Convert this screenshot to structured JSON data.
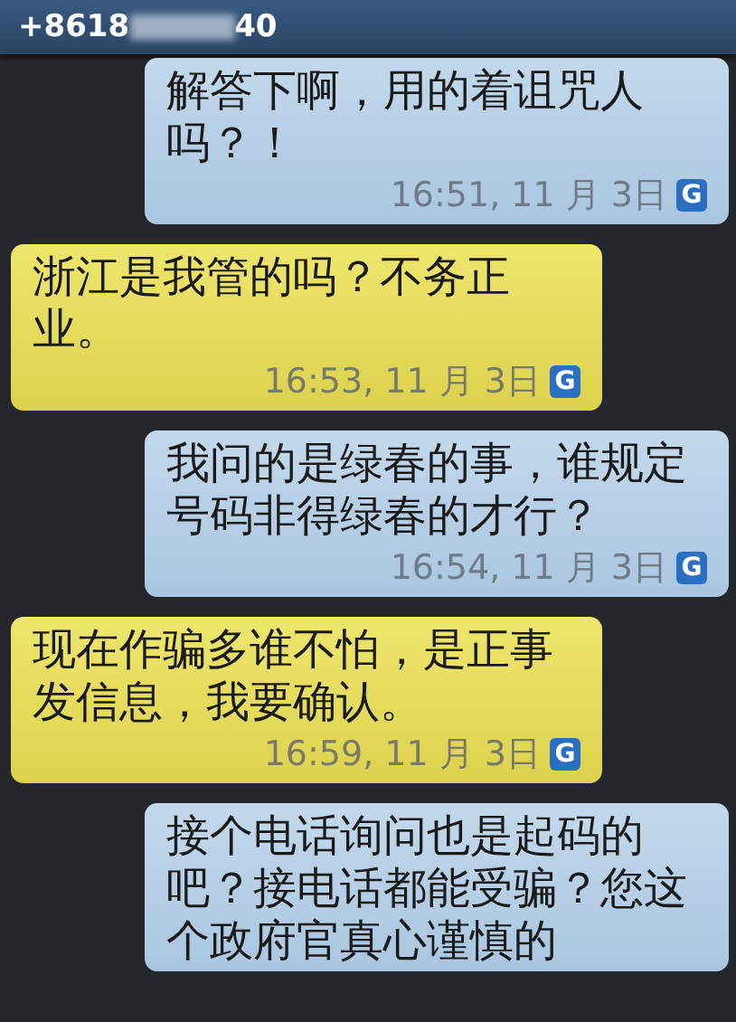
{
  "header": {
    "number_start": "+8618",
    "number_end": "40"
  },
  "messages": [
    {
      "kind": "outgoing",
      "text": "解答下啊，用的着诅咒人吗？！",
      "time": "16:51, 11 月 3日",
      "badge": "G"
    },
    {
      "kind": "incoming",
      "text": "浙江是我管的吗？不务正业。",
      "time": "16:53, 11 月 3日",
      "badge": "G"
    },
    {
      "kind": "outgoing",
      "text": "我问的是绿春的事，谁规定号码非得绿春的才行？",
      "time": "16:54, 11 月 3日",
      "badge": "G"
    },
    {
      "kind": "incoming",
      "text": "现在作骗多谁不怕，是正事发信息，我要确认。",
      "time": "16:59, 11 月 3日",
      "badge": "G"
    },
    {
      "kind": "outgoing",
      "text": "接个电话询问也是起码的吧？接电话都能受骗？您这个政府官真心谨慎的"
    }
  ]
}
